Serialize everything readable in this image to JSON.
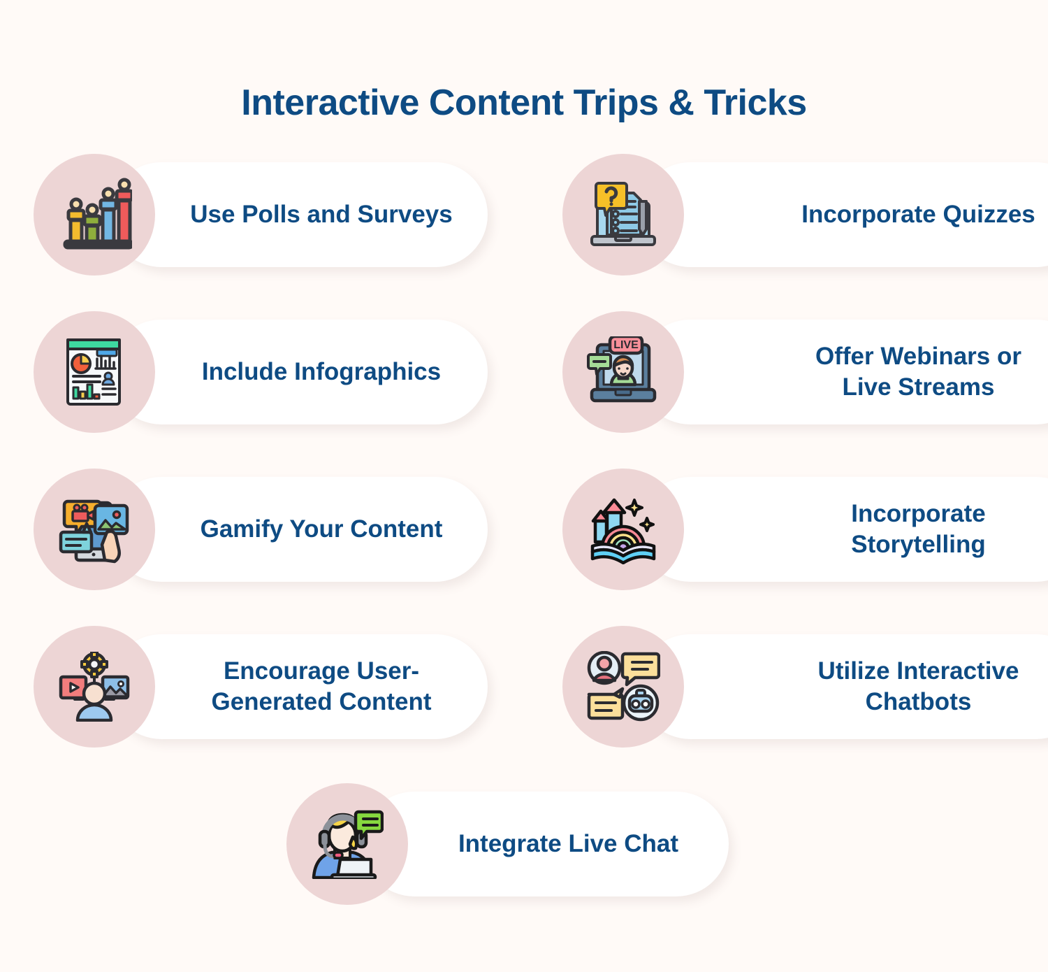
{
  "page": {
    "title": "Interactive Content Trips & Tricks",
    "background_color": "#FFFAF7",
    "title_color": "#0E4B83",
    "icon_circle_color": "#EDD5D5",
    "card_color": "#FFFFFF"
  },
  "cards": [
    {
      "label": "Use Polls and Surveys",
      "icon": "bar-chart-people-icon",
      "column": "left",
      "row": 1
    },
    {
      "label": "Incorporate Quizzes",
      "icon": "laptop-quiz-question-icon",
      "column": "right",
      "row": 1
    },
    {
      "label": "Include  Infographics",
      "icon": "infographic-report-icon",
      "column": "left",
      "row": 2
    },
    {
      "label": "Offer Webinars or\nLive Streams",
      "icon": "live-stream-laptop-icon",
      "column": "right",
      "row": 2
    },
    {
      "label": "Gamify Your Content",
      "icon": "smartphone-media-hand-icon",
      "column": "left",
      "row": 3
    },
    {
      "label": "Incorporate\nStorytelling",
      "icon": "storybook-rainbow-castle-icon",
      "column": "right",
      "row": 3
    },
    {
      "label": "Encourage User-\nGenerated Content",
      "icon": "user-generated-content-icon",
      "column": "left",
      "row": 4
    },
    {
      "label": "Utilize Interactive\nChatbots",
      "icon": "chatbot-conversation-icon",
      "column": "right",
      "row": 4
    },
    {
      "label": "Integrate Live Chat",
      "icon": "support-agent-headset-icon",
      "column": "center",
      "row": 5
    }
  ]
}
